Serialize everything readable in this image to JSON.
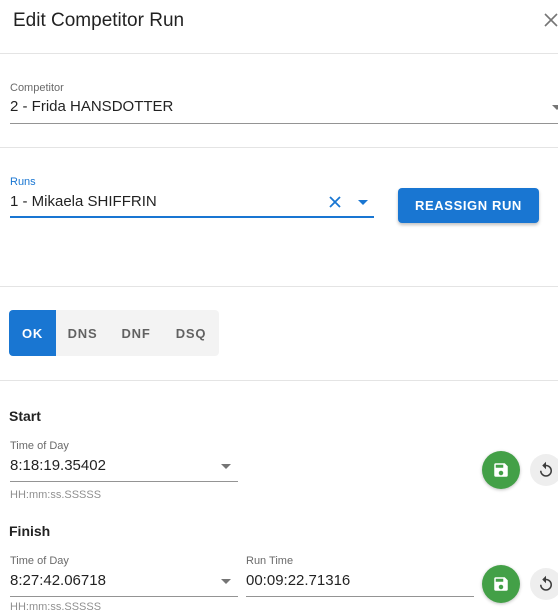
{
  "dialog": {
    "title": "Edit Competitor Run"
  },
  "competitor": {
    "label": "Competitor",
    "value": "2 - Frida HANSDOTTER"
  },
  "runs": {
    "label": "Runs",
    "value": "1 - Mikaela SHIFFRIN"
  },
  "reassign_label": "REASSIGN RUN",
  "status": {
    "options": [
      "OK",
      "DNS",
      "DNF",
      "DSQ"
    ],
    "selected": "OK"
  },
  "start": {
    "title": "Start",
    "time_label": "Time of Day",
    "time_value": "8:18:19.35402",
    "helper": "HH:mm:ss.SSSSS"
  },
  "finish": {
    "title": "Finish",
    "time_label": "Time of Day",
    "time_value": "8:27:42.06718",
    "run_time_label": "Run Time",
    "run_time_value": "00:09:22.71316",
    "helper": "HH:mm:ss.SSSSS"
  },
  "colors": {
    "primary": "#1976d2",
    "save": "#43a047"
  },
  "icons": [
    "close-icon",
    "clear-icon",
    "dropdown-arrow-icon",
    "save-icon",
    "reset-icon"
  ]
}
